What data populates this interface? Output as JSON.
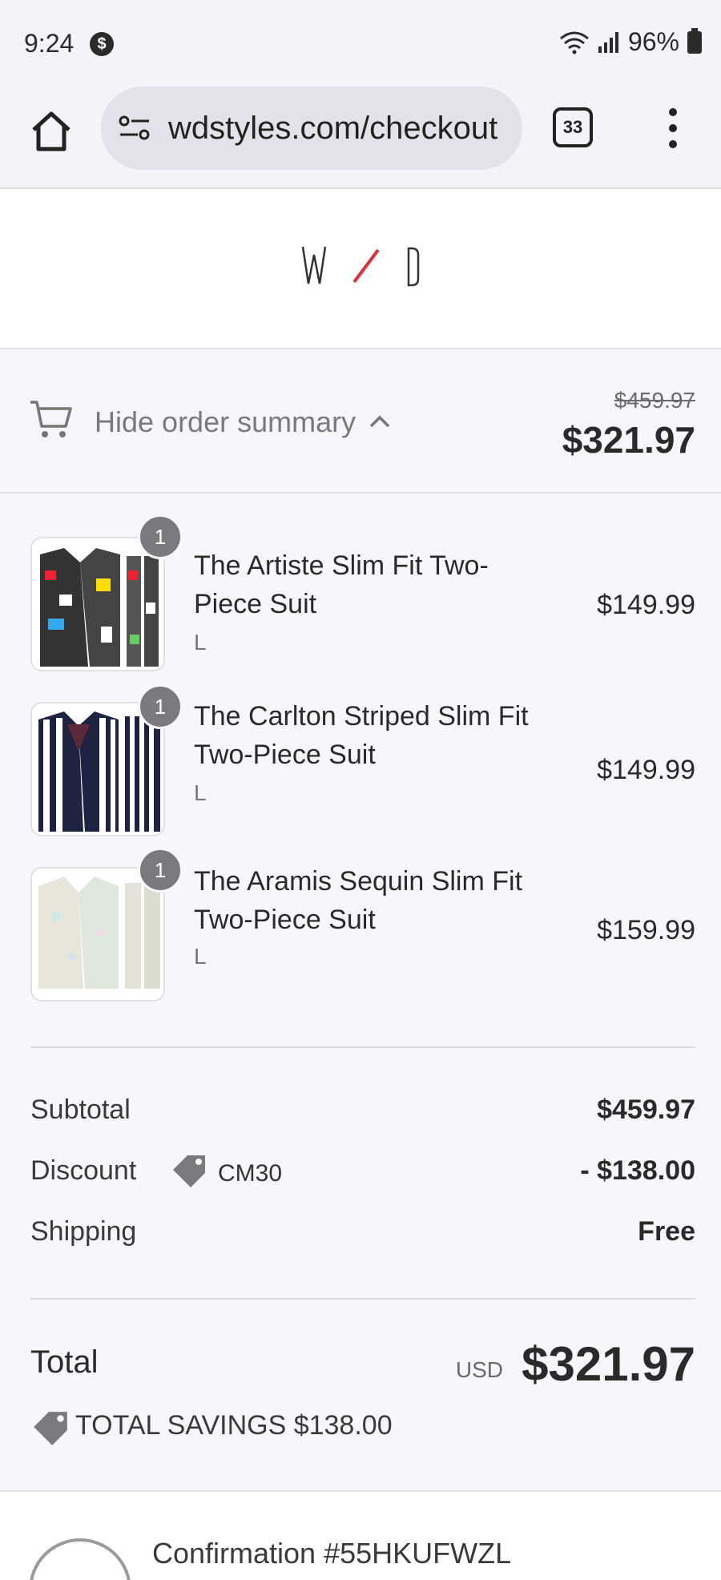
{
  "status_bar": {
    "time": "9:24",
    "battery": "96%"
  },
  "browser": {
    "url": "wdstyles.com/checkout",
    "tab_count": "33"
  },
  "summary": {
    "toggle_label": "Hide order summary",
    "original_price": "$459.97",
    "total_price": "$321.97"
  },
  "items": [
    {
      "qty": "1",
      "name": "The Artiste Slim Fit Two-Piece Suit",
      "variant": "L",
      "price": "$149.99"
    },
    {
      "qty": "1",
      "name": "The Carlton Striped Slim Fit Two-Piece Suit",
      "variant": "L",
      "price": "$149.99"
    },
    {
      "qty": "1",
      "name": "The Aramis Sequin Slim Fit Two-Piece Suit",
      "variant": "L",
      "price": "$159.99"
    }
  ],
  "totals": {
    "subtotal_label": "Subtotal",
    "subtotal_value": "$459.97",
    "discount_label": "Discount",
    "discount_code": "CM30",
    "discount_value": "- $138.00",
    "shipping_label": "Shipping",
    "shipping_value": "Free",
    "total_label": "Total",
    "currency": "USD",
    "total_value": "$321.97",
    "savings_text": "TOTAL SAVINGS $138.00"
  },
  "confirmation": {
    "text": "Confirmation #55HKUFWZL"
  },
  "colors": {
    "accent_red": "#d8333a",
    "badge_gray": "#7a7a7c"
  }
}
